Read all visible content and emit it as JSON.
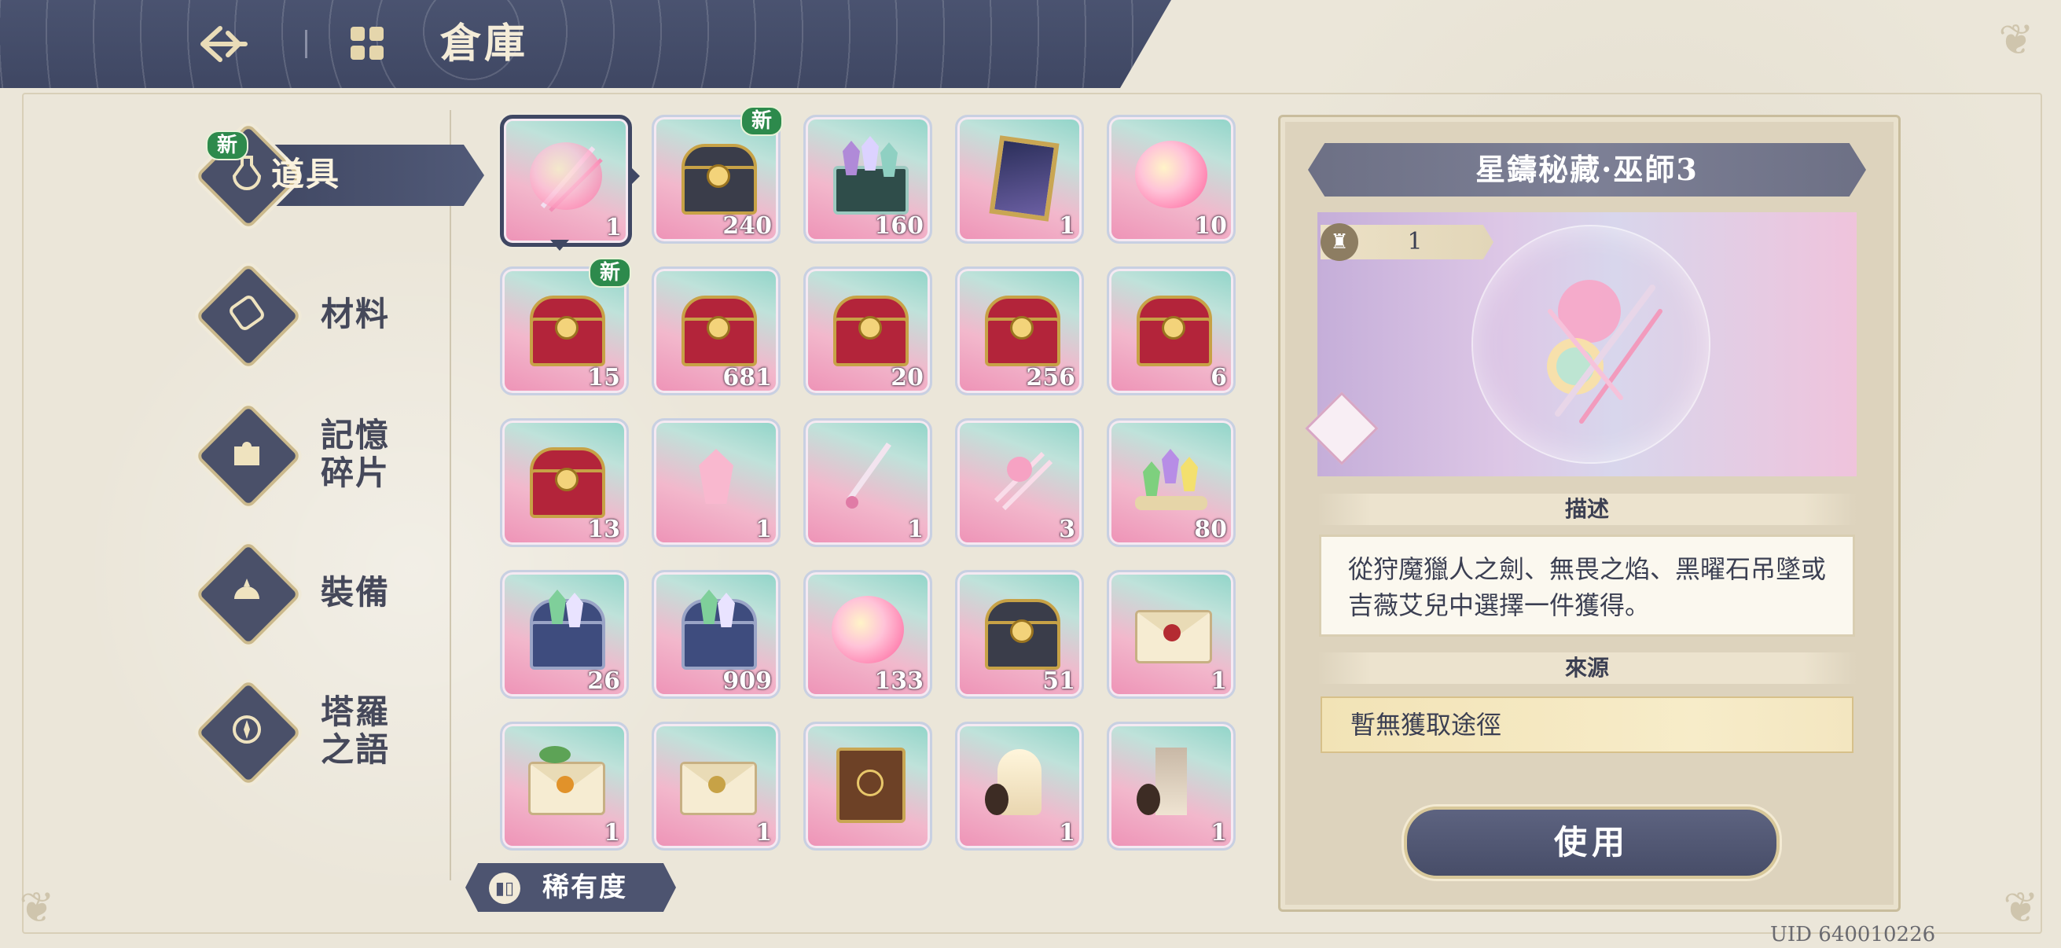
{
  "header": {
    "title": "倉庫",
    "back_icon": "back-arrow-icon",
    "warehouse_icon": "warehouse-icon"
  },
  "sidebar": {
    "tabs": [
      {
        "label": "道具",
        "icon": "potion-icon",
        "active": true,
        "badge": "新"
      },
      {
        "label": "材料",
        "icon": "scroll-icon",
        "active": false
      },
      {
        "label": "記憶\n碎片",
        "icon": "puzzle-icon",
        "active": false
      },
      {
        "label": "裝備",
        "icon": "helmet-icon",
        "active": false
      },
      {
        "label": "塔羅\n之語",
        "icon": "tarot-icon",
        "active": false
      }
    ]
  },
  "grid": {
    "items": [
      {
        "art": "weapon-bundle",
        "count": "1",
        "selected": true
      },
      {
        "art": "gold-chest",
        "count": "240",
        "badge": "新"
      },
      {
        "art": "crystal-chest",
        "count": "160"
      },
      {
        "art": "portrait-frame",
        "count": "1"
      },
      {
        "art": "pink-swirl",
        "count": "10"
      },
      {
        "art": "red-chest",
        "count": "15",
        "badge": "新"
      },
      {
        "art": "red-chest",
        "count": "681"
      },
      {
        "art": "red-chest",
        "count": "20"
      },
      {
        "art": "red-chest",
        "count": "256"
      },
      {
        "art": "red-chest",
        "count": "6"
      },
      {
        "art": "red-chest",
        "count": "13"
      },
      {
        "art": "pink-crystal",
        "count": "1"
      },
      {
        "art": "dagger",
        "count": "1"
      },
      {
        "art": "winged-blades",
        "count": "3"
      },
      {
        "art": "crystal-cluster",
        "count": "80"
      },
      {
        "art": "blue-chest",
        "count": "26"
      },
      {
        "art": "blue-chest",
        "count": "909"
      },
      {
        "art": "pink-swirl",
        "count": "133"
      },
      {
        "art": "gold-chest",
        "count": "51"
      },
      {
        "art": "red-envelope",
        "count": "1"
      },
      {
        "art": "green-envelope",
        "count": "1"
      },
      {
        "art": "gold-envelope",
        "count": "1"
      },
      {
        "art": "tome",
        "count": ""
      },
      {
        "art": "statue",
        "count": "1"
      },
      {
        "art": "tower",
        "count": "1"
      }
    ]
  },
  "detail": {
    "title": "星鑄秘藏·巫師3",
    "quantity": "1",
    "quantity_icon": "pouch-icon",
    "desc_label": "描述",
    "description": "從狩魔獵人之劍、無畏之焰、黑曜石吊墜或吉薇艾兒中選擇一件獲得。",
    "source_label": "來源",
    "source": "暫無獲取途徑",
    "use_button": "使用"
  },
  "rarity_button": {
    "label": "稀有度",
    "icon": "bar-chart-icon"
  },
  "uid": "UID 640010226",
  "colors": {
    "header": "#4a5370",
    "background": "#ebe6d9",
    "accent_green": "#2d8a4c",
    "button": "#4d5470"
  }
}
